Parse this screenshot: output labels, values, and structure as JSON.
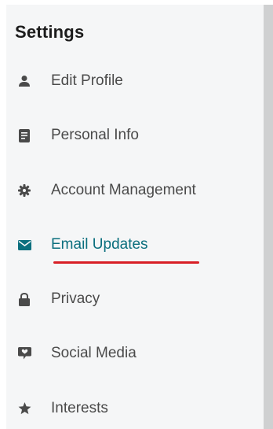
{
  "settings": {
    "title": "Settings",
    "items": [
      {
        "label": "Edit Profile",
        "icon": "user-icon"
      },
      {
        "label": "Personal Info",
        "icon": "document-icon"
      },
      {
        "label": "Account Management",
        "icon": "gear-icon"
      },
      {
        "label": "Email Updates",
        "icon": "envelope-icon",
        "active": true
      },
      {
        "label": "Privacy",
        "icon": "lock-icon"
      },
      {
        "label": "Social Media",
        "icon": "chat-icon"
      },
      {
        "label": "Interests",
        "icon": "star-icon"
      }
    ]
  },
  "colors": {
    "icon": "#4a4a4a",
    "active": "#0b6f7e",
    "underline": "#d81f26",
    "panel": "#f5f6f7"
  }
}
